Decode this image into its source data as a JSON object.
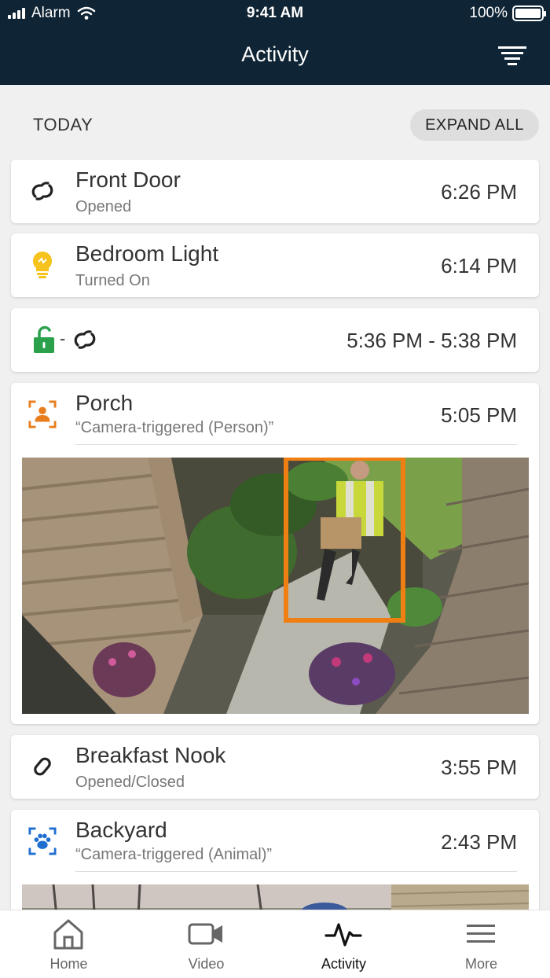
{
  "status_bar": {
    "carrier": "Alarm",
    "time": "9:41 AM",
    "battery": "100%"
  },
  "header": {
    "title": "Activity"
  },
  "section": {
    "title": "TODAY",
    "expand_label": "EXPAND ALL"
  },
  "events": [
    {
      "name": "Front Door",
      "detail": "Opened",
      "time": "6:26 PM",
      "icon": "link-open-icon"
    },
    {
      "name": "Bedroom Light",
      "detail": "Turned On",
      "time": "6:14 PM",
      "icon": "lightbulb-icon"
    },
    {
      "name": "",
      "detail": "",
      "time": "5:36 PM - 5:38 PM",
      "icon": "unlock-icon",
      "separator": "-"
    },
    {
      "name": "Porch",
      "detail": "“Camera-triggered (Person)”",
      "time": "5:05 PM",
      "icon": "person-detect-icon"
    },
    {
      "name": "Breakfast Nook",
      "detail": "Opened/Closed",
      "time": "3:55 PM",
      "icon": "link-closed-icon"
    },
    {
      "name": "Backyard",
      "detail": "“Camera-triggered (Animal)”",
      "time": "2:43 PM",
      "icon": "paw-detect-icon"
    }
  ],
  "colors": {
    "header": "#0f2434",
    "lock_green": "#2aa14a",
    "bulb_yellow": "#f6c21c",
    "detect_orange": "#e87d1e",
    "detect_blue": "#1f6fd1"
  },
  "tabs": [
    {
      "label": "Home",
      "icon": "home-icon",
      "active": false
    },
    {
      "label": "Video",
      "icon": "video-icon",
      "active": false
    },
    {
      "label": "Activity",
      "icon": "activity-icon",
      "active": true
    },
    {
      "label": "More",
      "icon": "menu-icon",
      "active": false
    }
  ]
}
